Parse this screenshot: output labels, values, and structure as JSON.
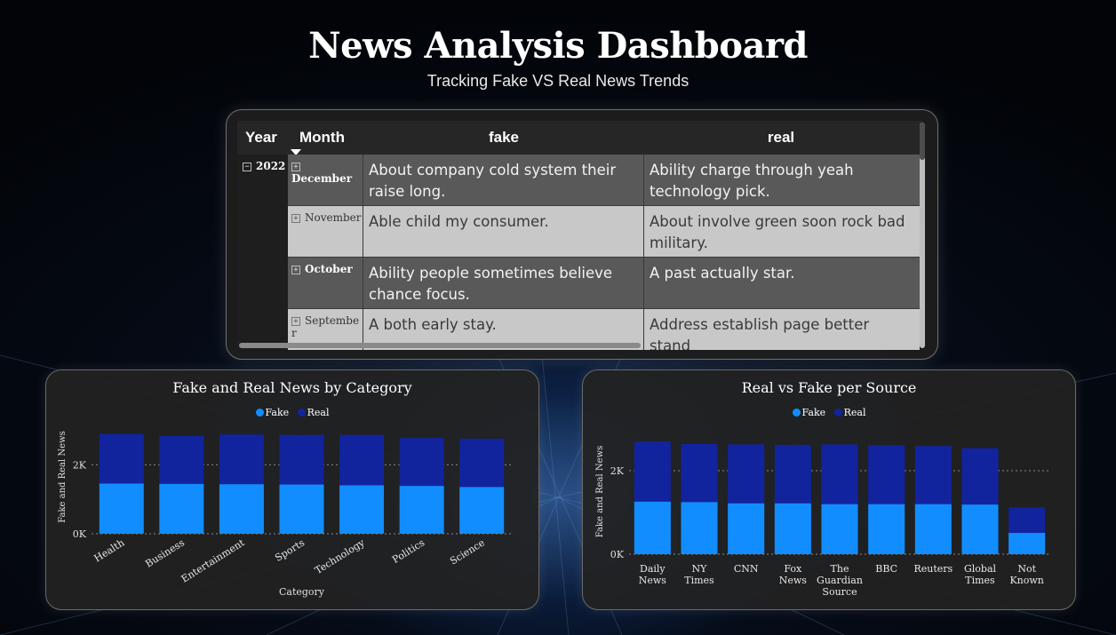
{
  "header": {
    "title": "News Analysis Dashboard",
    "subtitle": "Tracking Fake VS Real News Trends"
  },
  "colors": {
    "fake": "#118dff",
    "real": "#12239e"
  },
  "table": {
    "columns": [
      "Year",
      "Month",
      "fake",
      "real"
    ],
    "year": "2022",
    "rows": [
      {
        "month": "December",
        "fake": "About company cold system their raise long.",
        "real": "Ability charge through yeah technology pick."
      },
      {
        "month": "November",
        "fake": "Able child my consumer.",
        "real": "About involve green soon rock bad military."
      },
      {
        "month": "October",
        "fake": "Ability people sometimes believe chance focus.",
        "real": "A past actually star."
      },
      {
        "month": "Septembe r",
        "fake": "A both early stay.",
        "real": "Address establish page better stand"
      }
    ]
  },
  "chart_data": [
    {
      "type": "bar",
      "stacked": true,
      "title": "Fake and Real News by Category",
      "xlabel": "Category",
      "ylabel": "Fake and Real News",
      "categories": [
        "Health",
        "Business",
        "Entertainment",
        "Sports",
        "Technology",
        "Politics",
        "Science"
      ],
      "series": [
        {
          "name": "Fake",
          "values": [
            1460,
            1450,
            1440,
            1430,
            1410,
            1390,
            1360
          ]
        },
        {
          "name": "Real",
          "values": [
            1440,
            1390,
            1440,
            1440,
            1460,
            1390,
            1400
          ]
        }
      ],
      "yticks": [
        {
          "value": 0,
          "label": "0K"
        },
        {
          "value": 2000,
          "label": "2K"
        }
      ],
      "ylim": [
        0,
        3300
      ],
      "legend": "top-center"
    },
    {
      "type": "bar",
      "stacked": true,
      "title": "Real vs Fake per Source",
      "xlabel": "",
      "ylabel": "Fake and Real News",
      "categories": [
        "Daily News",
        "NY Times",
        "CNN",
        "Fox News",
        "The Guardian Source",
        "BBC",
        "Reuters",
        "Global Times",
        "Not Known"
      ],
      "series": [
        {
          "name": "Fake",
          "values": [
            1260,
            1250,
            1220,
            1220,
            1200,
            1200,
            1200,
            1190,
            510
          ]
        },
        {
          "name": "Real",
          "values": [
            1440,
            1390,
            1410,
            1400,
            1430,
            1410,
            1390,
            1350,
            610
          ]
        }
      ],
      "yticks": [
        {
          "value": 0,
          "label": "0K"
        },
        {
          "value": 2000,
          "label": "2K"
        }
      ],
      "ylim": [
        0,
        3000
      ],
      "legend": "top-center"
    }
  ]
}
